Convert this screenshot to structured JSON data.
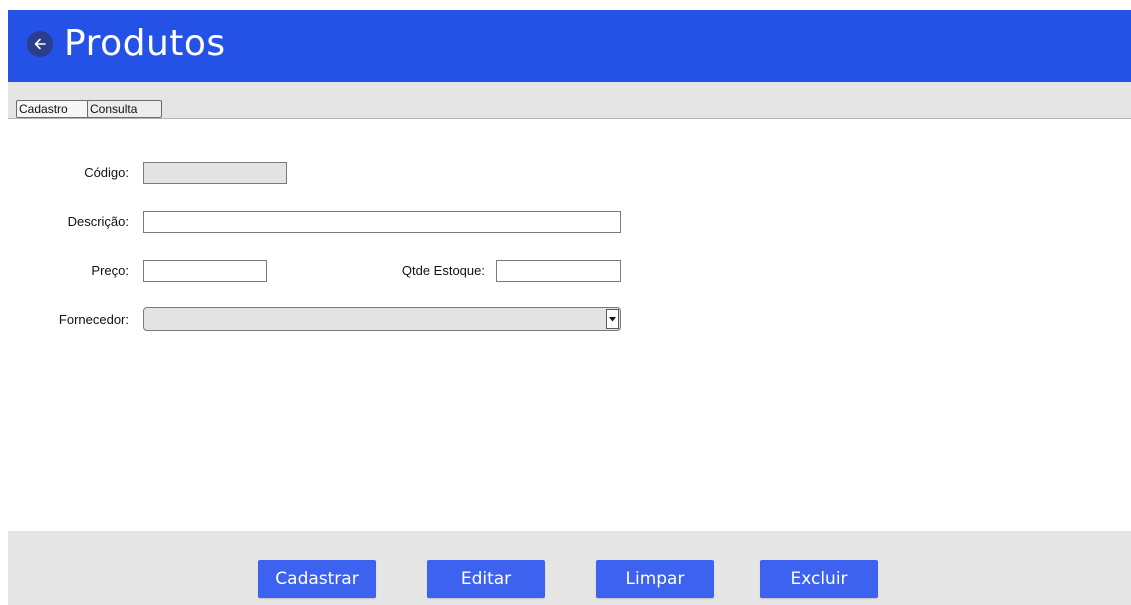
{
  "colors": {
    "header_bg": "#2552e6",
    "back_button_bg": "#2b3d8c",
    "button_bg": "#3d62f0",
    "bar_bg": "#e5e5e5"
  },
  "header": {
    "back_icon": "arrow-left-circle-icon",
    "title": "Produtos"
  },
  "tabs": [
    {
      "label": "Cadastro",
      "active": true
    },
    {
      "label": "Consulta",
      "active": false
    }
  ],
  "form": {
    "codigo": {
      "label": "Código:",
      "value": ""
    },
    "descricao": {
      "label": "Descrição:",
      "value": ""
    },
    "preco": {
      "label": "Preço:",
      "value": ""
    },
    "qtde_estoque": {
      "label": "Qtde Estoque:",
      "value": ""
    },
    "fornecedor": {
      "label": "Fornecedor:",
      "value": "",
      "arrow_icon": "dropdown-arrow-icon"
    }
  },
  "actions": {
    "cadastrar": "Cadastrar",
    "editar": "Editar",
    "limpar": "Limpar",
    "excluir": "Excluir"
  }
}
